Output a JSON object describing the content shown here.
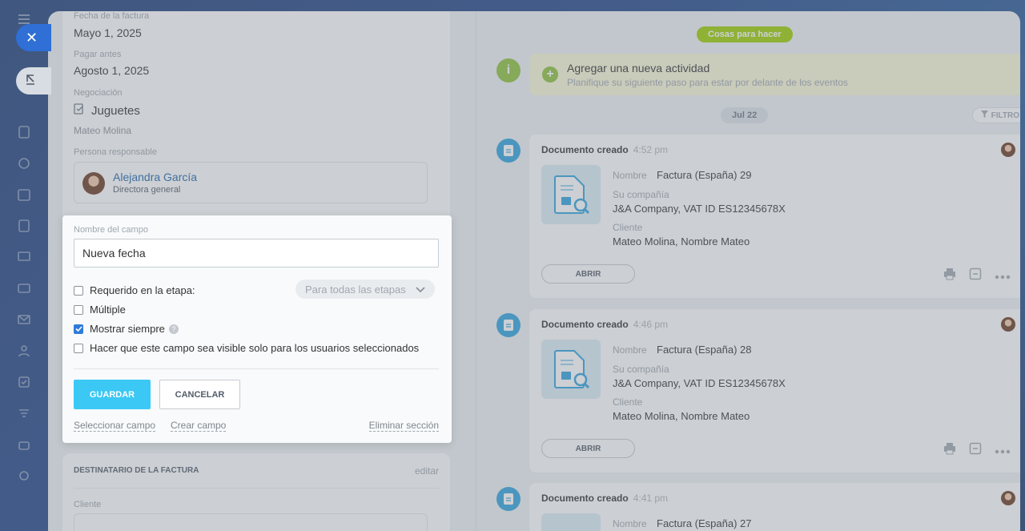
{
  "panel": {
    "invoice_date_label": "Fecha de la factura",
    "invoice_date": "Mayo 1, 2025",
    "pay_before_label": "Pagar antes",
    "pay_before": "Agosto 1, 2025",
    "deal_label": "Negociación",
    "deal_value": "Juguetes",
    "contact_name": "Mateo Molina",
    "responsible_label": "Persona responsable",
    "responsible_name": "Alejandra García",
    "responsible_role": "Directora general",
    "recipient_title": "DESTINATARIO DE LA FACTURA",
    "recipient_edit": "editar",
    "client_label": "Cliente"
  },
  "editor": {
    "field_name_label": "Nombre del campo",
    "field_name_value": "Nueva fecha",
    "opt_required": "Requerido en la etapa:",
    "stage_select": "Para todas las etapas",
    "opt_multiple": "Múltiple",
    "opt_always": "Mostrar siempre",
    "opt_visible": "Hacer que este campo sea visible solo para los usuarios seleccionados",
    "save": "GUARDAR",
    "cancel": "CANCELAR",
    "select_field": "Seleccionar campo",
    "create_field": "Crear campo",
    "delete_section": "Eliminar sección",
    "checked": {
      "required": false,
      "multiple": false,
      "always": true,
      "visible": false
    }
  },
  "timeline": {
    "todo_pill": "Cosas para hacer",
    "todo_title": "Agregar una nueva actividad",
    "todo_sub": "Planifique su siguiente paso para estar por delante de los eventos",
    "date_pill": "Jul 22",
    "filter": "FILTRO",
    "cards": [
      {
        "title": "Documento creado",
        "time": "4:52 pm",
        "name_label": "Nombre",
        "name": "Factura (España) 29",
        "company_label": "Su compañía",
        "company": "J&A Company, VAT ID ES12345678X",
        "client_label": "Cliente",
        "client": "Mateo Molina, Nombre Mateo",
        "open": "ABRIR"
      },
      {
        "title": "Documento creado",
        "time": "4:46 pm",
        "name_label": "Nombre",
        "name": "Factura (España) 28",
        "company_label": "Su compañía",
        "company": "J&A Company, VAT ID ES12345678X",
        "client_label": "Cliente",
        "client": "Mateo Molina, Nombre Mateo",
        "open": "ABRIR"
      },
      {
        "title": "Documento creado",
        "time": "4:41 pm",
        "name_label": "Nombre",
        "name": "Factura (España) 27"
      }
    ]
  },
  "colors": {
    "accent_green": "#9dcf00",
    "accent_blue": "#2fa4df",
    "save_button": "#3bc8f5"
  },
  "icons": [
    "close-icon",
    "pin-icon",
    "info-icon",
    "plus-icon",
    "filter-icon",
    "document-icon",
    "print-icon",
    "note-icon",
    "more-icon",
    "help-icon",
    "chevron-down-icon"
  ]
}
